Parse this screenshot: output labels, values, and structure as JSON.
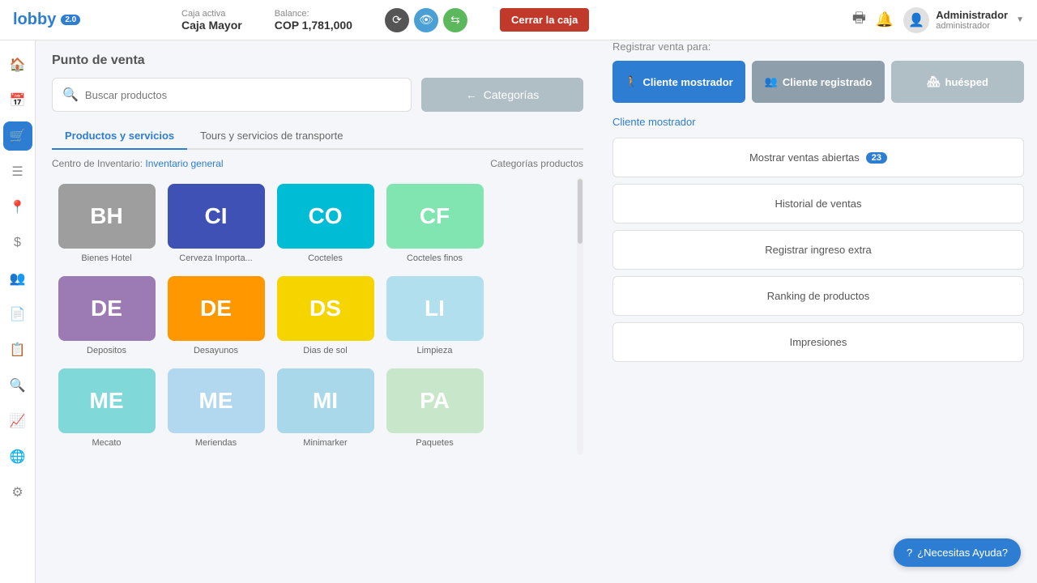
{
  "app": {
    "name": "lobby",
    "version": "2.0"
  },
  "header": {
    "caja_label": "Caja activa",
    "caja_name": "Caja Mayor",
    "balance_label": "Balance:",
    "balance_value": "COP 1,781,000",
    "cerrar_label": "Cerrar la caja"
  },
  "user": {
    "name": "Administrador",
    "role": "administrador"
  },
  "sidebar": {
    "items": [
      "home",
      "calendar",
      "pos",
      "list",
      "map",
      "dollar",
      "users",
      "file",
      "clipboard",
      "search",
      "chart",
      "settings-circle",
      "settings"
    ]
  },
  "page": {
    "title": "Punto de venta",
    "search_placeholder": "Buscar productos",
    "categories_btn": "Categorías",
    "tabs": [
      "Productos y servicios",
      "Tours y servicios de transporte"
    ],
    "inventory_label": "Centro de Inventario:",
    "inventory_link": "Inventario general",
    "categories_label": "Categorías productos"
  },
  "categories": [
    {
      "abbr": "BH",
      "name": "Bienes Hotel",
      "color": "#9e9e9e"
    },
    {
      "abbr": "CI",
      "name": "Cerveza Importa...",
      "color": "#3f51b5"
    },
    {
      "abbr": "CO",
      "name": "Cocteles",
      "color": "#00bcd4"
    },
    {
      "abbr": "CF",
      "name": "Cocteles finos",
      "color": "#80e5b0"
    },
    {
      "abbr": "DE",
      "name": "Depositos",
      "color": "#9c7bb5"
    },
    {
      "abbr": "DE",
      "name": "Desayunos",
      "color": "#ff9800"
    },
    {
      "abbr": "DS",
      "name": "Dias de sol",
      "color": "#f6d400"
    },
    {
      "abbr": "LI",
      "name": "Limpieza",
      "color": "#b2dfee"
    },
    {
      "abbr": "ME",
      "name": "Mecato",
      "color": "#80d8d8"
    },
    {
      "abbr": "ME",
      "name": "Meriendas",
      "color": "#b2d8f0"
    },
    {
      "abbr": "MI",
      "name": "Minimarker",
      "color": "#a8d8ea"
    },
    {
      "abbr": "PA",
      "name": "Paquetes",
      "color": "#c8e6c9"
    }
  ],
  "right_panel": {
    "register_label": "Registrar venta para:",
    "btn_mostrador": "Cliente mostrador",
    "btn_registrado": "Cliente registrado",
    "btn_huesped": "huésped",
    "selected_customer": "Cliente mostrador",
    "actions": [
      {
        "label": "Mostrar ventas abiertas",
        "badge": "23"
      },
      {
        "label": "Historial de ventas",
        "badge": null
      },
      {
        "label": "Registrar ingreso extra",
        "badge": null
      },
      {
        "label": "Ranking de productos",
        "badge": null
      },
      {
        "label": "Impresiones",
        "badge": null
      }
    ]
  },
  "help": {
    "label": "¿Necesitas Ayuda?"
  }
}
